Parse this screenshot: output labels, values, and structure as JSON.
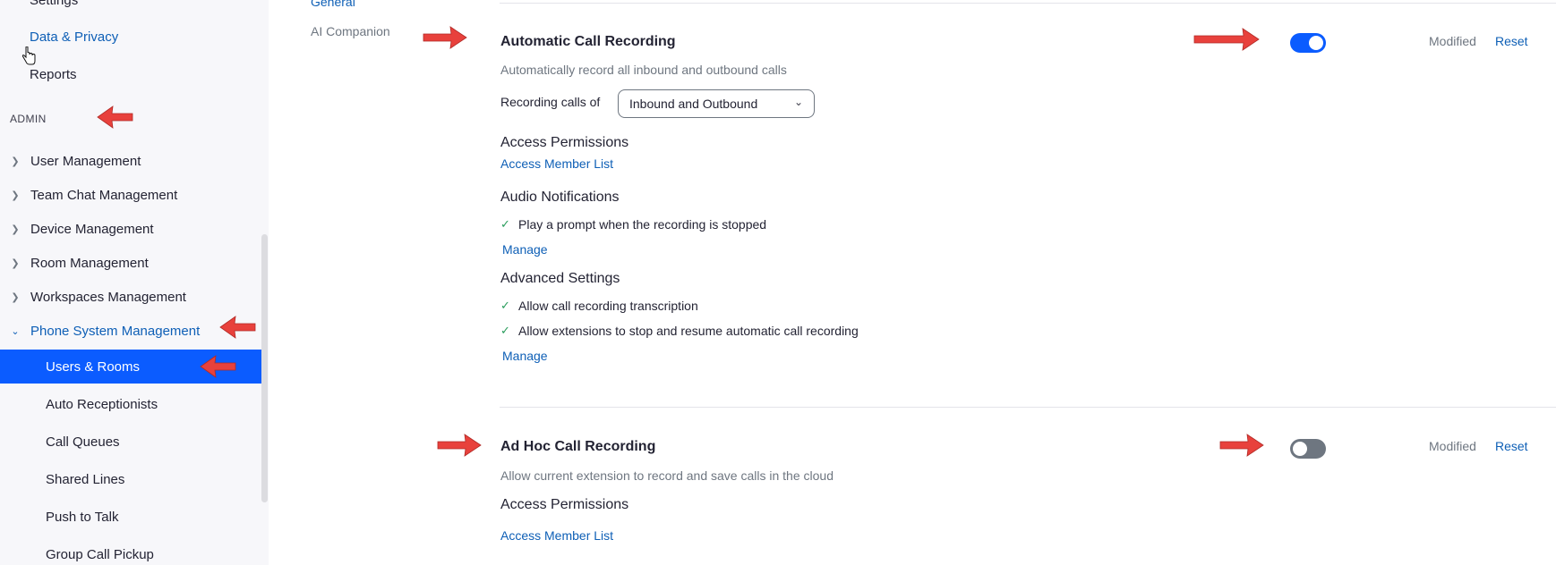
{
  "sidebar": {
    "top_items": {
      "settings": "Settings",
      "data_privacy": "Data & Privacy",
      "reports": "Reports"
    },
    "admin_heading": "ADMIN",
    "groups": [
      {
        "label": "User Management"
      },
      {
        "label": "Team Chat Management"
      },
      {
        "label": "Device Management"
      },
      {
        "label": "Room Management"
      },
      {
        "label": "Workspaces Management"
      },
      {
        "label": "Phone System Management"
      }
    ],
    "phone_sub_items": [
      {
        "label": "Users & Rooms",
        "active": true
      },
      {
        "label": "Auto Receptionists"
      },
      {
        "label": "Call Queues"
      },
      {
        "label": "Shared Lines"
      },
      {
        "label": "Push to Talk"
      },
      {
        "label": "Group Call Pickup"
      }
    ]
  },
  "tabs": {
    "general": "General",
    "ai_companion": "AI Companion"
  },
  "auto_recording": {
    "title": "Automatic Call Recording",
    "description": "Automatically record all inbound and outbound calls",
    "recording_label": "Recording calls of",
    "recording_value": "Inbound and Outbound",
    "access_heading": "Access Permissions",
    "access_link": "Access Member List",
    "audio_heading": "Audio Notifications",
    "audio_items": [
      "Play a prompt when the recording is stopped"
    ],
    "audio_manage": "Manage",
    "advanced_heading": "Advanced Settings",
    "advanced_items": [
      "Allow call recording transcription",
      "Allow extensions to stop and resume automatic call recording"
    ],
    "advanced_manage": "Manage",
    "toggle_state": "on",
    "modified": "Modified",
    "reset": "Reset"
  },
  "adhoc_recording": {
    "title": "Ad Hoc Call Recording",
    "description": "Allow current extension to record and save calls in the cloud",
    "access_heading": "Access Permissions",
    "access_link": "Access Member List",
    "toggle_state": "off",
    "modified": "Modified",
    "reset": "Reset"
  },
  "colors": {
    "accent": "#0b5cff",
    "link": "#0e5fb6",
    "annotation_arrow": "#e8413c"
  }
}
